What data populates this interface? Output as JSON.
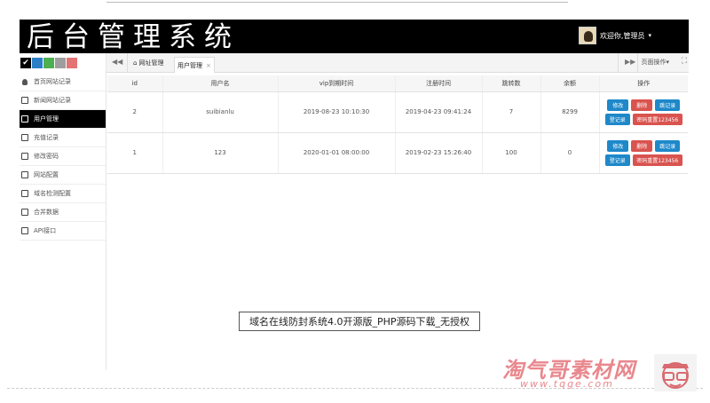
{
  "app": {
    "title": "后台管理系统",
    "user_label": "欢迎你,管理员",
    "caret": "▾"
  },
  "theme": {
    "swatches": [
      "#000000",
      "#2b7fc7",
      "#4caf50",
      "#9e9e9e",
      "#e57373"
    ],
    "primary": "#1e88c9",
    "danger": "#d9534f"
  },
  "sidebar": {
    "items": [
      {
        "label": "首页网站记录",
        "icon": "person-icon",
        "active": false
      },
      {
        "label": "新闻网站记录",
        "icon": "bookmark-icon",
        "active": false
      },
      {
        "label": "用户管理",
        "icon": "bookmark-icon",
        "active": true
      },
      {
        "label": "充值记录",
        "icon": "bookmark-icon",
        "active": false
      },
      {
        "label": "修改密码",
        "icon": "bookmark-icon",
        "active": false
      },
      {
        "label": "网站配置",
        "icon": "bookmark-icon",
        "active": false
      },
      {
        "label": "域名检测配置",
        "icon": "bookmark-icon",
        "active": false
      },
      {
        "label": "合并数据",
        "icon": "bookmark-icon",
        "active": false
      },
      {
        "label": "API接口",
        "icon": "bookmark-icon",
        "active": false
      }
    ]
  },
  "tabbar": {
    "back": "◀◀",
    "tabs": [
      {
        "label": "网址管理",
        "icon": "home-icon"
      },
      {
        "label": "用户管理",
        "close": "×"
      }
    ],
    "forward": "▶▶",
    "page_op": "页面操作▾",
    "fullscreen": "⛶"
  },
  "table": {
    "headers": [
      "id",
      "用户名",
      "vip到期时间",
      "注册时间",
      "跳转数",
      "余额",
      "操作"
    ],
    "rows": [
      {
        "id": "2",
        "username": "suibianlu",
        "vip": "2019-08-23 10:10:30",
        "reg": "2019-04-23 09:41:24",
        "jumps": "7",
        "balance": "8299"
      },
      {
        "id": "1",
        "username": "123",
        "vip": "2020-01-01 08:00:00",
        "reg": "2019-02-23 15:26:40",
        "jumps": "100",
        "balance": "0"
      }
    ],
    "row1_buttons": {
      "edit": "修改",
      "delete": "删除",
      "record": "跳记录",
      "record2": "登记录",
      "reset": "密码重置123456"
    },
    "row2_buttons": {
      "edit": "修改",
      "delete": "删除",
      "record": "跳记录",
      "record2": "登记录",
      "reset": "密码重置123456"
    }
  },
  "caption": "域名在线防封系统4.0开源版_PHP源码下载_无授权",
  "watermark": {
    "title": "淘气哥素材网",
    "url": "www.tqge.com"
  }
}
